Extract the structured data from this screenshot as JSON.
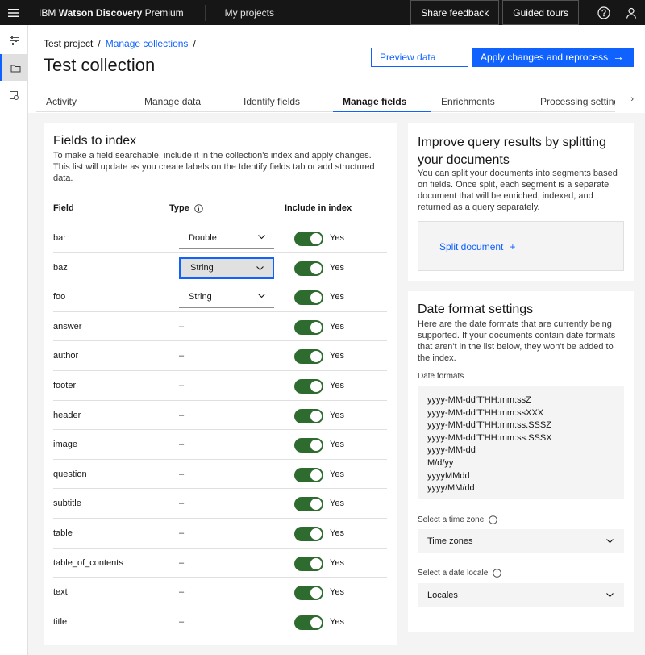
{
  "topbar": {
    "brand_prefix": "IBM",
    "brand_bold": "Watson Discovery",
    "brand_suffix": "Premium",
    "nav_link": "My projects",
    "share_feedback": "Share feedback",
    "guided_tours": "Guided tours"
  },
  "header": {
    "breadcrumb": [
      "Test project",
      "Manage collections"
    ],
    "title": "Test collection",
    "preview_label": "Preview data",
    "apply_label": "Apply changes and reprocess"
  },
  "tabs": [
    "Activity",
    "Manage data",
    "Identify fields",
    "Manage fields",
    "Enrichments",
    "Processing settings"
  ],
  "active_tab": "Manage fields",
  "fields": {
    "title": "Fields to index",
    "description": "To make a field searchable, include it in the collection's index and apply changes. This list will update as you create labels on the Identify fields tab or add structured data.",
    "col_field": "Field",
    "col_type": "Type",
    "col_include": "Include in index",
    "toggle_label": "Yes",
    "rows": [
      {
        "name": "bar",
        "type": "Double",
        "select": true,
        "focused": false,
        "included": true
      },
      {
        "name": "baz",
        "type": "String",
        "select": true,
        "focused": true,
        "included": true
      },
      {
        "name": "foo",
        "type": "String",
        "select": true,
        "focused": false,
        "included": true
      },
      {
        "name": "answer",
        "type": "–",
        "select": false,
        "focused": false,
        "included": true
      },
      {
        "name": "author",
        "type": "–",
        "select": false,
        "focused": false,
        "included": true
      },
      {
        "name": "footer",
        "type": "–",
        "select": false,
        "focused": false,
        "included": true
      },
      {
        "name": "header",
        "type": "–",
        "select": false,
        "focused": false,
        "included": true
      },
      {
        "name": "image",
        "type": "–",
        "select": false,
        "focused": false,
        "included": true
      },
      {
        "name": "question",
        "type": "–",
        "select": false,
        "focused": false,
        "included": true
      },
      {
        "name": "subtitle",
        "type": "–",
        "select": false,
        "focused": false,
        "included": true
      },
      {
        "name": "table",
        "type": "–",
        "select": false,
        "focused": false,
        "included": true
      },
      {
        "name": "table_of_contents",
        "type": "–",
        "select": false,
        "focused": false,
        "included": true
      },
      {
        "name": "text",
        "type": "–",
        "select": false,
        "focused": false,
        "included": true
      },
      {
        "name": "title",
        "type": "–",
        "select": false,
        "focused": false,
        "included": true
      }
    ]
  },
  "split": {
    "title": "Improve query results by splitting your documents",
    "description": "You can split your documents into segments based on fields. Once split, each segment is a separate document that will be enriched, indexed, and returned as a query separately.",
    "link_label": "Split document",
    "link_icon": "+"
  },
  "date": {
    "title": "Date format settings",
    "description": "Here are the date formats that are currently being supported. If your documents contain date formats that aren't in the list below, they won't be added to the index.",
    "formats_label": "Date formats",
    "formats": [
      "yyyy-MM-dd'T'HH:mm:ssZ",
      "yyyy-MM-dd'T'HH:mm:ssXXX",
      "yyyy-MM-dd'T'HH:mm:ss.SSSZ",
      "yyyy-MM-dd'T'HH:mm:ss.SSSX",
      "yyyy-MM-dd",
      "M/d/yy",
      "yyyyMMdd",
      "yyyy/MM/dd"
    ],
    "timezone_label": "Select a time zone",
    "timezone_value": "Time zones",
    "locale_label": "Select a date locale",
    "locale_value": "Locales"
  }
}
